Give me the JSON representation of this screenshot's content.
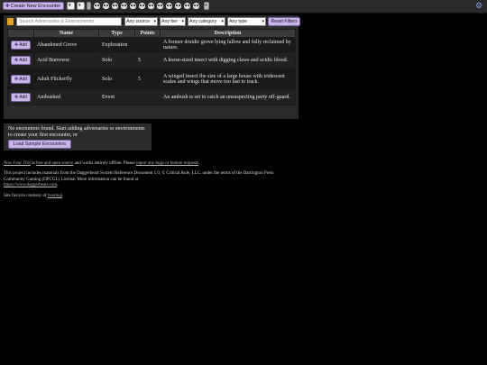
{
  "topbar": {
    "create_button": "Create New Encounter",
    "skull_count": 12
  },
  "filters": {
    "search_placeholder": "Search Adversaries & Environments",
    "source": "Any source",
    "tier": "Any tier",
    "category": "Any category",
    "type": "Any type",
    "reset": "Reset Filters"
  },
  "table": {
    "headers": [
      "Name",
      "Type",
      "Points",
      "Description"
    ],
    "add_label": "Add",
    "rows": [
      {
        "name": "Abandoned Grove",
        "type": "Exploration",
        "points": "",
        "description": "A former druidic grove lying fallow and fully reclaimed by nature."
      },
      {
        "name": "Acid Burrower",
        "type": "Solo",
        "points": "5",
        "description": "A horse-sized insect with digging claws and acidic blood."
      },
      {
        "name": "Adult Flickerfly",
        "type": "Solo",
        "points": "5",
        "description": "A winged insect the size of a large house with iridescent scales and wings that move too fast to track."
      },
      {
        "name": "Ambushed",
        "type": "Event",
        "points": "",
        "description": "An ambush is set to catch an unsuspecting party off-guard."
      }
    ]
  },
  "empty": {
    "text": "No encounters found. Start adding adversaries or environments to create your first encounter, or",
    "button": "Load Sample Encounters"
  },
  "footer": {
    "p1_title": "Now Fear This",
    "p1_is": " is ",
    "p1_link1": "free and open source",
    "p1_mid": " and works entirely offline. Please ",
    "p1_link2": "report any bugs or feature requests",
    "p1_end": ".",
    "p2": "This project includes materials from the Daggerheart System Reference Document 1.0, © Critical Role, LLC. under the terms of the Darrington Press Community Gaming (DPCGL) License. More information can be found at",
    "p2_link": "https://www.daggerheart.com",
    "p2_end": ".",
    "p3": "Site favicon courtesy of ",
    "p3_link": "twemoji",
    "p3_end": "."
  }
}
